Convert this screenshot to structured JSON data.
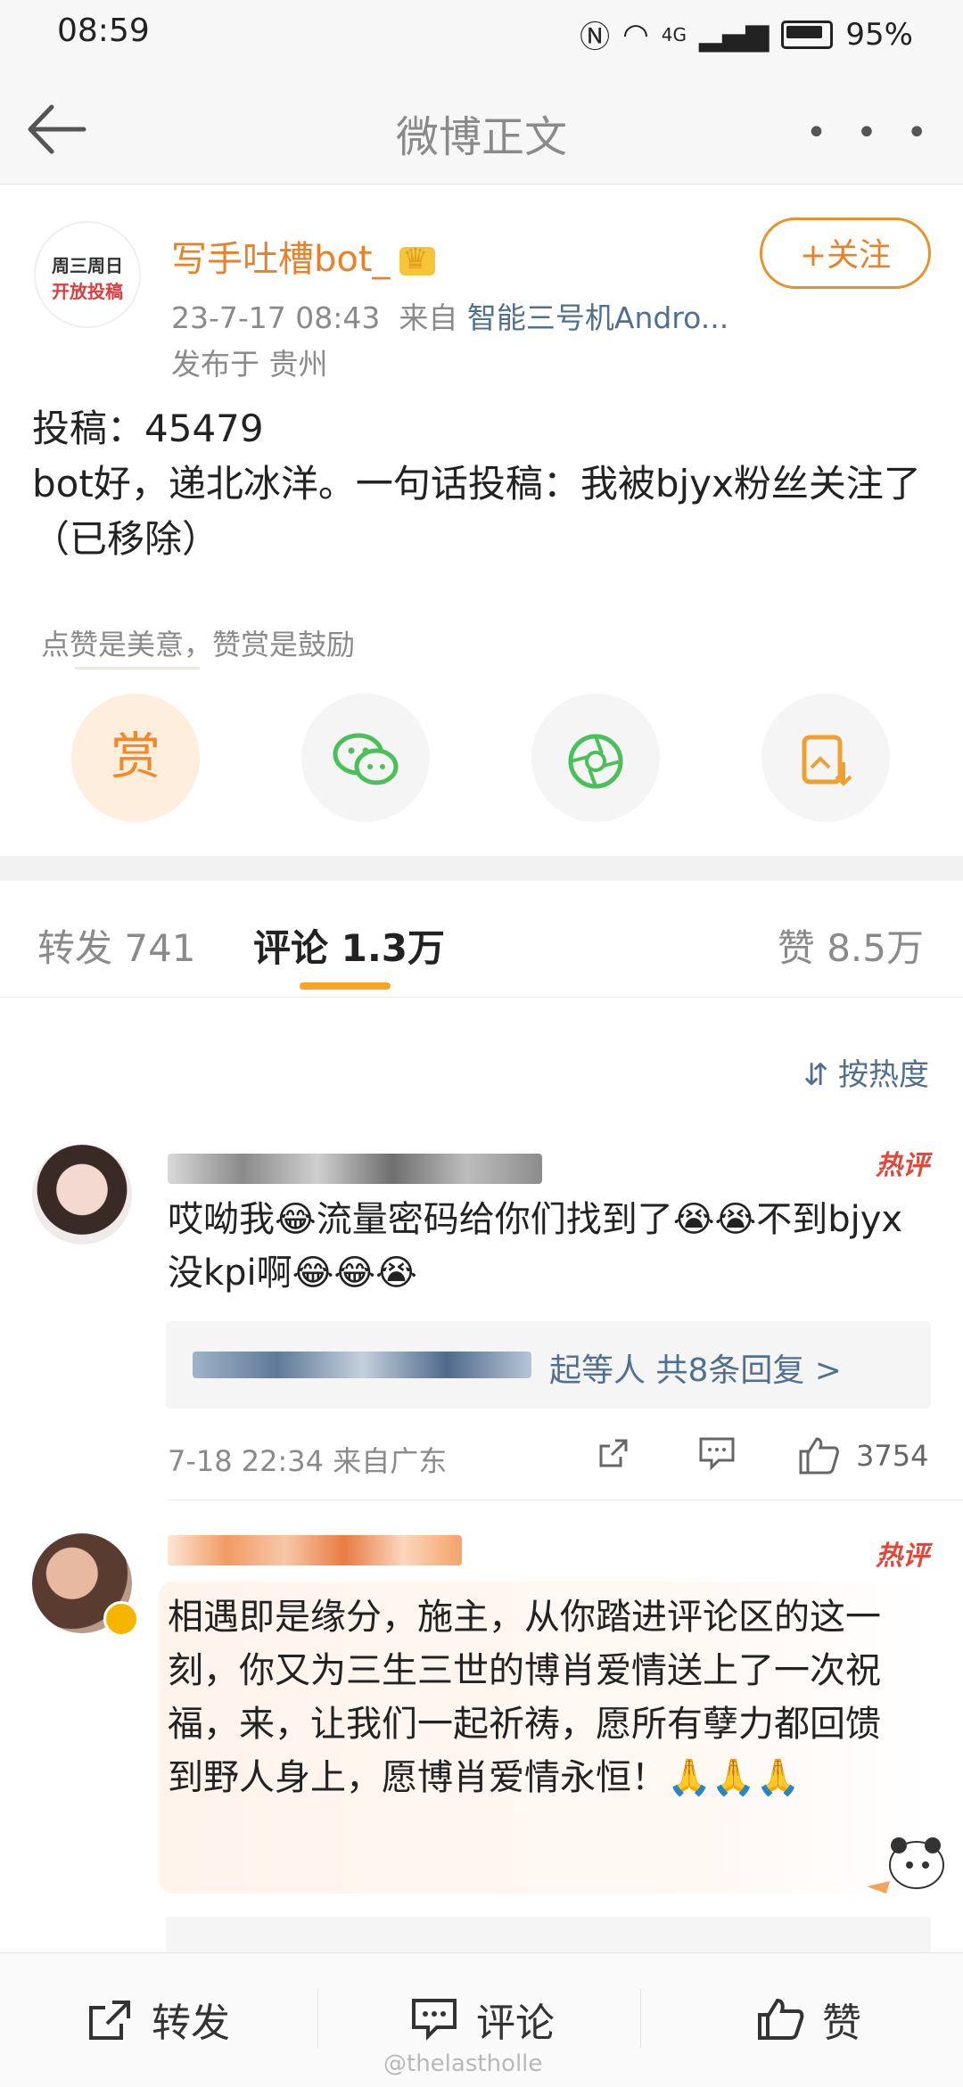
{
  "status": {
    "time": "08:59",
    "signal": "4G",
    "battery": "95%"
  },
  "header": {
    "title": "微博正文",
    "more": "• • •"
  },
  "post": {
    "avatar_line1": "周三周日",
    "avatar_line2": "开放投稿",
    "author": "写手吐槽bot_",
    "follow_label": "+关注",
    "date": "23-7-17 08:43",
    "from_label": "来自",
    "source": "智能三号机Andro...",
    "location": "发布于 贵州",
    "content_line1": "投稿：45479",
    "content_line2": "bot好，递北冰洋。一句话投稿：我被bjyx粉丝关注了（已移除）",
    "reward_hint": "点赞是美意，赞赏是鼓励",
    "reward_glyph": "赏"
  },
  "tabs": {
    "repost": "转发 741",
    "comment": "评论 1.3万",
    "like": "赞 8.5万",
    "sort": "按热度"
  },
  "comments": [
    {
      "hot": "热评",
      "text": "哎呦我😂流量密码给你们找到了😭😭不到bjyx没kpi啊😂😂😭",
      "replies": "起等人  共8条回复 >",
      "time": "7-18 22:34 来自广东",
      "likes": "3754"
    },
    {
      "hot": "热评",
      "text": "相遇即是缘分，施主，从你踏进评论区的这一刻，你又为三生三世的博肖爱情送上了一次祝福，来，让我们一起祈祷，愿所有孽力都回馈到野人身上，愿博肖爱情永恒！🙏🙏🙏"
    }
  ],
  "bottom": {
    "repost": "转发",
    "comment": "评论",
    "like": "赞"
  },
  "watermark": "@thelastholle",
  "colors": {
    "accent": "#e8822a",
    "link": "#51708f",
    "hot": "#e0483a",
    "indicator": "#f5a623"
  }
}
